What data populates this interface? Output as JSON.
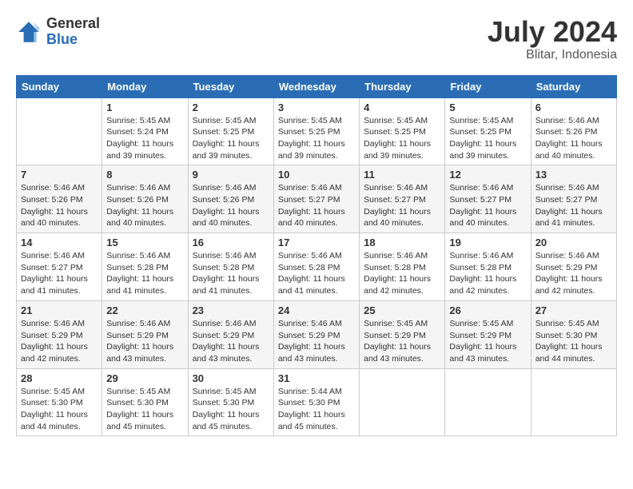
{
  "header": {
    "logo_general": "General",
    "logo_blue": "Blue",
    "title": "July 2024",
    "location": "Blitar, Indonesia"
  },
  "days_of_week": [
    "Sunday",
    "Monday",
    "Tuesday",
    "Wednesday",
    "Thursday",
    "Friday",
    "Saturday"
  ],
  "weeks": [
    [
      {
        "day": "",
        "sunrise": "",
        "sunset": "",
        "daylight": ""
      },
      {
        "day": "1",
        "sunrise": "Sunrise: 5:45 AM",
        "sunset": "Sunset: 5:24 PM",
        "daylight": "Daylight: 11 hours and 39 minutes."
      },
      {
        "day": "2",
        "sunrise": "Sunrise: 5:45 AM",
        "sunset": "Sunset: 5:25 PM",
        "daylight": "Daylight: 11 hours and 39 minutes."
      },
      {
        "day": "3",
        "sunrise": "Sunrise: 5:45 AM",
        "sunset": "Sunset: 5:25 PM",
        "daylight": "Daylight: 11 hours and 39 minutes."
      },
      {
        "day": "4",
        "sunrise": "Sunrise: 5:45 AM",
        "sunset": "Sunset: 5:25 PM",
        "daylight": "Daylight: 11 hours and 39 minutes."
      },
      {
        "day": "5",
        "sunrise": "Sunrise: 5:45 AM",
        "sunset": "Sunset: 5:25 PM",
        "daylight": "Daylight: 11 hours and 39 minutes."
      },
      {
        "day": "6",
        "sunrise": "Sunrise: 5:46 AM",
        "sunset": "Sunset: 5:26 PM",
        "daylight": "Daylight: 11 hours and 40 minutes."
      }
    ],
    [
      {
        "day": "7",
        "sunrise": "Sunrise: 5:46 AM",
        "sunset": "Sunset: 5:26 PM",
        "daylight": "Daylight: 11 hours and 40 minutes."
      },
      {
        "day": "8",
        "sunrise": "Sunrise: 5:46 AM",
        "sunset": "Sunset: 5:26 PM",
        "daylight": "Daylight: 11 hours and 40 minutes."
      },
      {
        "day": "9",
        "sunrise": "Sunrise: 5:46 AM",
        "sunset": "Sunset: 5:26 PM",
        "daylight": "Daylight: 11 hours and 40 minutes."
      },
      {
        "day": "10",
        "sunrise": "Sunrise: 5:46 AM",
        "sunset": "Sunset: 5:27 PM",
        "daylight": "Daylight: 11 hours and 40 minutes."
      },
      {
        "day": "11",
        "sunrise": "Sunrise: 5:46 AM",
        "sunset": "Sunset: 5:27 PM",
        "daylight": "Daylight: 11 hours and 40 minutes."
      },
      {
        "day": "12",
        "sunrise": "Sunrise: 5:46 AM",
        "sunset": "Sunset: 5:27 PM",
        "daylight": "Daylight: 11 hours and 40 minutes."
      },
      {
        "day": "13",
        "sunrise": "Sunrise: 5:46 AM",
        "sunset": "Sunset: 5:27 PM",
        "daylight": "Daylight: 11 hours and 41 minutes."
      }
    ],
    [
      {
        "day": "14",
        "sunrise": "Sunrise: 5:46 AM",
        "sunset": "Sunset: 5:27 PM",
        "daylight": "Daylight: 11 hours and 41 minutes."
      },
      {
        "day": "15",
        "sunrise": "Sunrise: 5:46 AM",
        "sunset": "Sunset: 5:28 PM",
        "daylight": "Daylight: 11 hours and 41 minutes."
      },
      {
        "day": "16",
        "sunrise": "Sunrise: 5:46 AM",
        "sunset": "Sunset: 5:28 PM",
        "daylight": "Daylight: 11 hours and 41 minutes."
      },
      {
        "day": "17",
        "sunrise": "Sunrise: 5:46 AM",
        "sunset": "Sunset: 5:28 PM",
        "daylight": "Daylight: 11 hours and 41 minutes."
      },
      {
        "day": "18",
        "sunrise": "Sunrise: 5:46 AM",
        "sunset": "Sunset: 5:28 PM",
        "daylight": "Daylight: 11 hours and 42 minutes."
      },
      {
        "day": "19",
        "sunrise": "Sunrise: 5:46 AM",
        "sunset": "Sunset: 5:28 PM",
        "daylight": "Daylight: 11 hours and 42 minutes."
      },
      {
        "day": "20",
        "sunrise": "Sunrise: 5:46 AM",
        "sunset": "Sunset: 5:29 PM",
        "daylight": "Daylight: 11 hours and 42 minutes."
      }
    ],
    [
      {
        "day": "21",
        "sunrise": "Sunrise: 5:46 AM",
        "sunset": "Sunset: 5:29 PM",
        "daylight": "Daylight: 11 hours and 42 minutes."
      },
      {
        "day": "22",
        "sunrise": "Sunrise: 5:46 AM",
        "sunset": "Sunset: 5:29 PM",
        "daylight": "Daylight: 11 hours and 43 minutes."
      },
      {
        "day": "23",
        "sunrise": "Sunrise: 5:46 AM",
        "sunset": "Sunset: 5:29 PM",
        "daylight": "Daylight: 11 hours and 43 minutes."
      },
      {
        "day": "24",
        "sunrise": "Sunrise: 5:46 AM",
        "sunset": "Sunset: 5:29 PM",
        "daylight": "Daylight: 11 hours and 43 minutes."
      },
      {
        "day": "25",
        "sunrise": "Sunrise: 5:45 AM",
        "sunset": "Sunset: 5:29 PM",
        "daylight": "Daylight: 11 hours and 43 minutes."
      },
      {
        "day": "26",
        "sunrise": "Sunrise: 5:45 AM",
        "sunset": "Sunset: 5:29 PM",
        "daylight": "Daylight: 11 hours and 43 minutes."
      },
      {
        "day": "27",
        "sunrise": "Sunrise: 5:45 AM",
        "sunset": "Sunset: 5:30 PM",
        "daylight": "Daylight: 11 hours and 44 minutes."
      }
    ],
    [
      {
        "day": "28",
        "sunrise": "Sunrise: 5:45 AM",
        "sunset": "Sunset: 5:30 PM",
        "daylight": "Daylight: 11 hours and 44 minutes."
      },
      {
        "day": "29",
        "sunrise": "Sunrise: 5:45 AM",
        "sunset": "Sunset: 5:30 PM",
        "daylight": "Daylight: 11 hours and 45 minutes."
      },
      {
        "day": "30",
        "sunrise": "Sunrise: 5:45 AM",
        "sunset": "Sunset: 5:30 PM",
        "daylight": "Daylight: 11 hours and 45 minutes."
      },
      {
        "day": "31",
        "sunrise": "Sunrise: 5:44 AM",
        "sunset": "Sunset: 5:30 PM",
        "daylight": "Daylight: 11 hours and 45 minutes."
      },
      {
        "day": "",
        "sunrise": "",
        "sunset": "",
        "daylight": ""
      },
      {
        "day": "",
        "sunrise": "",
        "sunset": "",
        "daylight": ""
      },
      {
        "day": "",
        "sunrise": "",
        "sunset": "",
        "daylight": ""
      }
    ]
  ]
}
